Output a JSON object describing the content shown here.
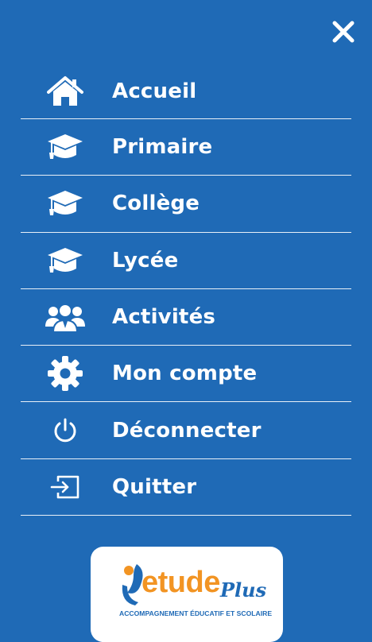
{
  "menu": {
    "close_icon": "close-icon",
    "items": [
      {
        "label": "Accueil",
        "icon": "home-icon"
      },
      {
        "label": "Primaire",
        "icon": "graduation-cap-icon"
      },
      {
        "label": "Collège",
        "icon": "graduation-cap-icon"
      },
      {
        "label": "Lycée",
        "icon": "graduation-cap-icon"
      },
      {
        "label": "Activités",
        "icon": "users-icon"
      },
      {
        "label": "Mon compte",
        "icon": "gear-icon"
      },
      {
        "label": "Déconnecter",
        "icon": "power-icon"
      },
      {
        "label": "Quitter",
        "icon": "exit-icon"
      }
    ]
  },
  "logo": {
    "word": "etude",
    "suffix": "Plus",
    "tagline": "ACCOMPAGNEMENT ÉDUCATIF ET SCOLAIRE"
  },
  "colors": {
    "background": "#1f6ab6",
    "text": "#ffffff",
    "logo_orange": "#f29423",
    "logo_blue": "#1f6ab6"
  }
}
